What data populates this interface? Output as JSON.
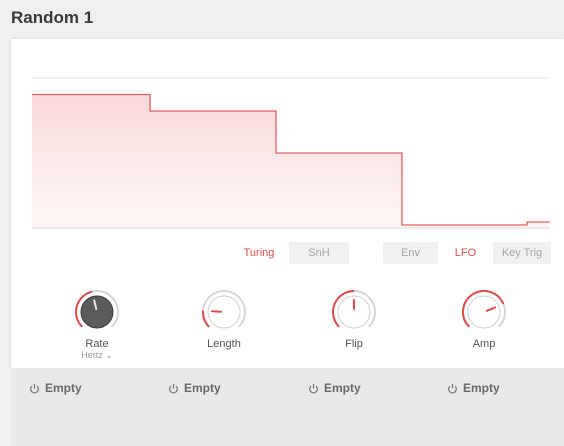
{
  "header": {
    "title": "Random 1"
  },
  "colors": {
    "accent": "#e04a4a",
    "curve_fill": "#fbe2e2",
    "knob_dark": "#5a5a5a",
    "knob_light": "#ffffff"
  },
  "graph": {
    "description_steps": [
      0.89,
      0.78,
      0.5,
      0.02,
      0.04
    ]
  },
  "mode_tabs": {
    "items": [
      {
        "label": "Turing",
        "active": true
      },
      {
        "label": "SnH",
        "active": false
      }
    ]
  },
  "trigger_tabs": {
    "items": [
      {
        "label": "Env",
        "active": false
      },
      {
        "label": "LFO",
        "active": true
      },
      {
        "label": "Key Trig",
        "active": false
      }
    ]
  },
  "knobs": [
    {
      "label": "Rate",
      "sublabel": "Hertz ⌄",
      "value": 0.45,
      "style": "dark"
    },
    {
      "label": "Length",
      "sublabel": "",
      "value": 0.18,
      "style": "light"
    },
    {
      "label": "Flip",
      "sublabel": "",
      "value": 0.5,
      "style": "light"
    },
    {
      "label": "Amp",
      "sublabel": "",
      "value": 0.75,
      "style": "light"
    }
  ],
  "slots": [
    {
      "label": "Empty",
      "icon": "power-icon"
    },
    {
      "label": "Empty",
      "icon": "power-icon"
    },
    {
      "label": "Empty",
      "icon": "power-icon"
    },
    {
      "label": "Empty",
      "icon": "power-icon"
    }
  ]
}
